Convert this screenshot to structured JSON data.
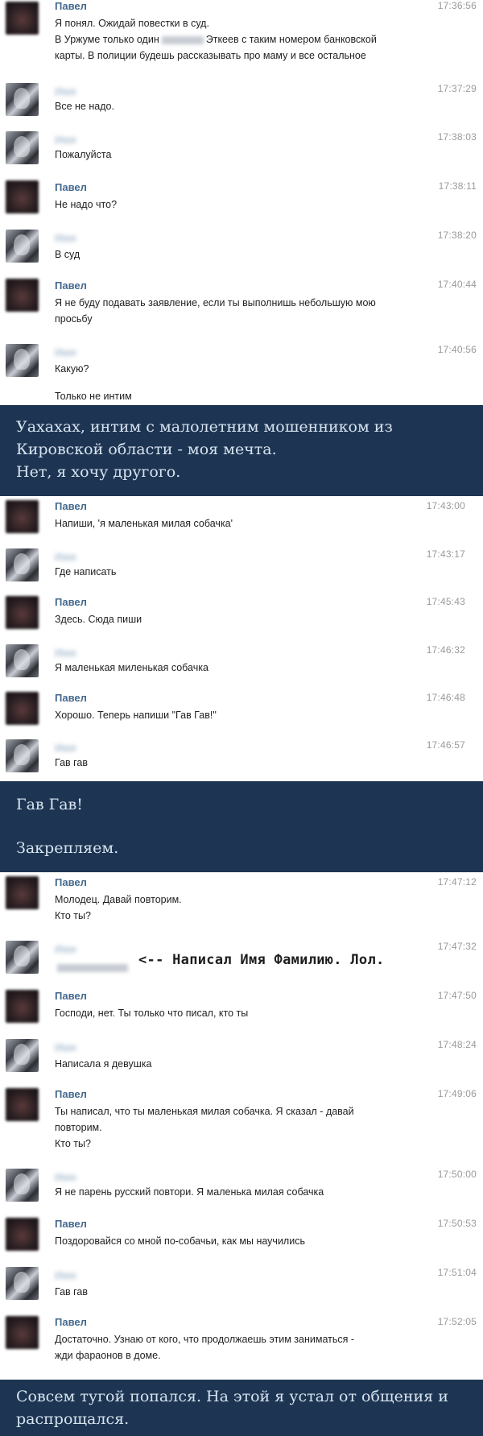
{
  "names": {
    "pavel": "Павел",
    "other": "Имя"
  },
  "messages": [
    {
      "time": "17:36:56",
      "lines": [
        "Я понял. Ожидай повестки в суд.",
        "В Уржуме только один",
        "Эткеев с таким номером банковской",
        "карты. В полиции будешь рассказывать про маму и все остальное"
      ]
    },
    {
      "time": "17:37:29",
      "lines": [
        "Все не надо."
      ]
    },
    {
      "time": "17:38:03",
      "lines": [
        "Пожалуйста"
      ]
    },
    {
      "time": "17:38:11",
      "lines": [
        "Не надо что?"
      ]
    },
    {
      "time": "17:38:20",
      "lines": [
        "В суд"
      ]
    },
    {
      "time": "17:40:44",
      "lines": [
        "Я не буду подавать заявление, если ты выполнишь небольшую мою",
        "просьбу"
      ]
    },
    {
      "time": "17:40:56",
      "lines": [
        "Какую?",
        "Только не интим"
      ]
    },
    {
      "time": "17:43:00",
      "lines": [
        "Напиши, 'я маленькая милая собачка'"
      ]
    },
    {
      "time": "17:43:17",
      "lines": [
        "Где написать"
      ]
    },
    {
      "time": "17:45:43",
      "lines": [
        "Здесь. Сюда пиши"
      ]
    },
    {
      "time": "17:46:32",
      "lines": [
        "Я маленькая миленькая собачка"
      ]
    },
    {
      "time": "17:46:48",
      "lines": [
        "Хорошо. Теперь напиши \"Гав Гав!\""
      ]
    },
    {
      "time": "17:46:57",
      "lines": [
        "Гав гав"
      ]
    },
    {
      "time": "17:47:12",
      "lines": [
        "Молодец. Давай повторим.",
        "Кто ты?"
      ]
    },
    {
      "time": "17:47:32",
      "lines": [],
      "annotation": "<-- Написал Имя Фамилию. Лол."
    },
    {
      "time": "17:47:50",
      "lines": [
        "Господи, нет. Ты только что писал, кто ты"
      ]
    },
    {
      "time": "17:48:24",
      "lines": [
        "Написала я девушка"
      ]
    },
    {
      "time": "17:49:06",
      "lines": [
        "Ты написал, что ты маленькая милая собачка. Я сказал - давай",
        "повторим.",
        "Кто ты?"
      ]
    },
    {
      "time": "17:50:00",
      "lines": [
        "Я не парень русский повтори. Я маленька милая собачка"
      ]
    },
    {
      "time": "17:50:53",
      "lines": [
        "Поздоровайся со мной по-собачьи, как мы научились"
      ]
    },
    {
      "time": "17:51:04",
      "lines": [
        "Гав гав"
      ]
    },
    {
      "time": "17:52:05",
      "lines": [
        "Достаточно. Узнаю от кого, что продолжаешь этим заниматься -",
        "жди фараонов в доме."
      ]
    }
  ],
  "bands": [
    {
      "lines": [
        "Уахахах, интим с малолетним мошенником из",
        "Кировской области - моя мечта.",
        "Нет, я хочу другого."
      ]
    },
    {
      "lines": [
        "Гав Гав!",
        "",
        "Закрепляем."
      ]
    },
    {
      "lines": [
        "Совсем тугой попался. На этой я устал от общения и",
        "распрощался."
      ]
    }
  ],
  "colors": {
    "band_bg": "#1d3552",
    "band_text": "#d7e3f0",
    "name_color": "#45688e",
    "time_color": "#9a9a9a"
  }
}
